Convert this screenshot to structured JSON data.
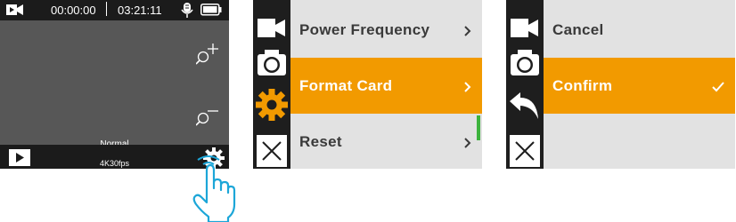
{
  "camera": {
    "record_time": "00:00:00",
    "remaining_time": "03:21:11",
    "mode": "Normal",
    "resolution": "4K30fps",
    "icons": [
      "video-mode-icon",
      "microphone-icon",
      "battery-icon",
      "zoom-in-icon",
      "zoom-out-icon",
      "playback-icon",
      "settings-icon",
      "tap-hand-icon"
    ]
  },
  "menu1": {
    "items": [
      {
        "label": "Power Frequency",
        "indicator": "chevron-right"
      },
      {
        "label": "Format Card",
        "indicator": "chevron-right",
        "selected": true
      },
      {
        "label": "Reset",
        "indicator": "chevron-right"
      }
    ],
    "sidebar_icons": [
      "video-icon",
      "camera-icon",
      "settings-gear-icon",
      "close-icon"
    ],
    "accent_color": "#f29a00",
    "scrollbar_color": "#3db33d"
  },
  "menu2": {
    "items": [
      {
        "label": "Cancel"
      },
      {
        "label": "Confirm",
        "indicator": "check",
        "selected": true
      }
    ],
    "sidebar_icons": [
      "video-icon",
      "camera-icon",
      "back-arrow-icon",
      "close-icon"
    ]
  }
}
